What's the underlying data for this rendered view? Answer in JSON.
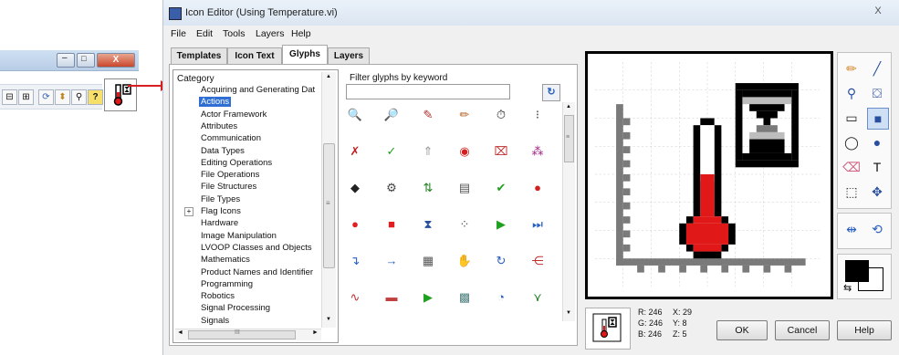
{
  "lv_window": {
    "close_glyph": "X",
    "min_glyph": "–",
    "max_glyph": "□",
    "toolbar_icons": [
      "align-icon",
      "distribute-icon",
      "resize-icon",
      "reorder-icon",
      "search-icon",
      "help-icon"
    ]
  },
  "dialog": {
    "title": "Icon Editor (Using Temperature.vi)",
    "close_glyph": "X",
    "menu": [
      "File",
      "Edit",
      "Tools",
      "Layers",
      "Help"
    ],
    "tabs": [
      "Templates",
      "Icon Text",
      "Glyphs",
      "Layers"
    ],
    "active_tab": "Glyphs"
  },
  "category": {
    "header": "Category",
    "items": [
      "Acquiring and Generating Dat",
      "Actions",
      "Actor Framework",
      "Attributes",
      "Communication",
      "Data Types",
      "Editing Operations",
      "File Operations",
      "File Structures",
      "File Types",
      "Flag Icons",
      "Hardware",
      "Image Manipulation",
      "LVOOP Classes and Objects",
      "Mathematics",
      "Product Names and Identifier",
      "Programming",
      "Robotics",
      "Signal Processing",
      "Signals"
    ],
    "selected": "Actions",
    "expand_glyph": "+",
    "scroll_up": "▲",
    "scroll_down": "▼",
    "scroll_left": "◄",
    "scroll_right": "►",
    "grip": "≡",
    "hgrip": "III"
  },
  "glyphs": {
    "filter_label": "Filter glyphs by keyword",
    "filter_value": "",
    "filter_button": "↻",
    "scroll_up": "▲",
    "scroll_down": "▼",
    "grip": "≡",
    "items": [
      {
        "icon": "zoom-icon",
        "glyph": "🔍",
        "color": "#333"
      },
      {
        "icon": "zoom-in-icon",
        "glyph": "🔎",
        "color": "#333"
      },
      {
        "icon": "pen-icon",
        "glyph": "✎",
        "color": "#b03030"
      },
      {
        "icon": "pencil-icon",
        "glyph": "✏",
        "color": "#b06020"
      },
      {
        "icon": "stopwatch-icon",
        "glyph": "⏱",
        "color": "#222"
      },
      {
        "icon": "cursor-icon",
        "glyph": "⁝",
        "color": "#333"
      },
      {
        "icon": "reject-icon",
        "glyph": "✗",
        "color": "#c02020"
      },
      {
        "icon": "check-icon",
        "glyph": "✓",
        "color": "#20a020"
      },
      {
        "icon": "up-chevrons-icon",
        "glyph": "⇑",
        "color": "#999"
      },
      {
        "icon": "record-icon",
        "glyph": "◉",
        "color": "#d02020"
      },
      {
        "icon": "cancel-doc-icon",
        "glyph": "⌧",
        "color": "#c03030"
      },
      {
        "icon": "multi-x-icon",
        "glyph": "⁂",
        "color": "#a02080"
      },
      {
        "icon": "graduation-icon",
        "glyph": "◆",
        "color": "#222"
      },
      {
        "icon": "gear-icon",
        "glyph": "⚙",
        "color": "#444"
      },
      {
        "icon": "sort-icon",
        "glyph": "⇅",
        "color": "#208020"
      },
      {
        "icon": "document-icon",
        "glyph": "▤",
        "color": "#555"
      },
      {
        "icon": "small-check-icon",
        "glyph": "✔",
        "color": "#20a020"
      },
      {
        "icon": "red-dot-icon",
        "glyph": "●",
        "color": "#d02020"
      },
      {
        "icon": "record-button-icon",
        "glyph": "●",
        "color": "#e02020"
      },
      {
        "icon": "stop-icon",
        "glyph": "■",
        "color": "#e02020"
      },
      {
        "icon": "hourglass-icon",
        "glyph": "⧗",
        "color": "#2a50a0"
      },
      {
        "icon": "dots-icon",
        "glyph": "⁘",
        "color": "#444"
      },
      {
        "icon": "run-icon",
        "glyph": "▶",
        "color": "#20a020"
      },
      {
        "icon": "next-icon",
        "glyph": "⏭",
        "color": "#2a60c0"
      },
      {
        "icon": "turn-arrow-icon",
        "glyph": "↴",
        "color": "#2a60c0"
      },
      {
        "icon": "arrow-right-icon",
        "glyph": "→",
        "color": "#2a60c0"
      },
      {
        "icon": "notes-icon",
        "glyph": "▦",
        "color": "#555"
      },
      {
        "icon": "hand-icon",
        "glyph": "✋",
        "color": "#b07020"
      },
      {
        "icon": "loop-icon",
        "glyph": "↻",
        "color": "#2a60c0"
      },
      {
        "icon": "tree-icon",
        "glyph": "⋲",
        "color": "#c03030"
      },
      {
        "icon": "signal-icon",
        "glyph": "∿",
        "color": "#c03030"
      },
      {
        "icon": "bar-icon",
        "glyph": "▬",
        "color": "#c04040"
      },
      {
        "icon": "play-icon",
        "glyph": "▶",
        "color": "#20a020"
      },
      {
        "icon": "stack-icon",
        "glyph": "▩",
        "color": "#508080"
      },
      {
        "icon": "timer-icon",
        "glyph": "◔",
        "color": "#2a60c0"
      },
      {
        "icon": "merge-icon",
        "glyph": "⋎",
        "color": "#208020"
      }
    ]
  },
  "canvas": {
    "pixel_colors": {
      "black": "#000000",
      "red": "#e01818",
      "gray": "#7a7a7a",
      "light_gray": "#bdbdbd",
      "white": "#ffffff"
    }
  },
  "tools": [
    {
      "icon": "pencil-icon",
      "glyph": "✏",
      "color": "#d08020"
    },
    {
      "icon": "line-icon",
      "glyph": "╱",
      "color": "#2a4fa0"
    },
    {
      "icon": "dropper-icon",
      "glyph": "⚲",
      "color": "#2a4fa0"
    },
    {
      "icon": "fill-bucket-icon",
      "glyph": "⛋",
      "color": "#2a4fa0"
    },
    {
      "icon": "rectangle-icon",
      "glyph": "▭",
      "color": "#222"
    },
    {
      "icon": "filled-rectangle-icon",
      "glyph": "■",
      "color": "#2a4fa0"
    },
    {
      "icon": "ellipse-icon",
      "glyph": "◯",
      "color": "#222"
    },
    {
      "icon": "filled-ellipse-icon",
      "glyph": "●",
      "color": "#2a4fa0"
    },
    {
      "icon": "eraser-icon",
      "glyph": "⌫",
      "color": "#d06080"
    },
    {
      "icon": "text-icon",
      "glyph": "T",
      "color": "#111"
    },
    {
      "icon": "select-icon",
      "glyph": "⬚",
      "color": "#222"
    },
    {
      "icon": "move-icon",
      "glyph": "✥",
      "color": "#2a4fa0"
    }
  ],
  "tools2": [
    {
      "icon": "flip-horizontal-icon",
      "glyph": "⇹",
      "color": "#2a60c0"
    },
    {
      "icon": "rotate-icon",
      "glyph": "⟲",
      "color": "#2a60c0"
    }
  ],
  "colors": {
    "foreground": "#000000",
    "background": "#ffffff",
    "swap_glyph": "⇆"
  },
  "readout": {
    "r": "R: 246",
    "g": "G: 246",
    "b": "B: 246",
    "x": "X: 29",
    "y": "Y: 8",
    "z": "Z: 5"
  },
  "buttons": {
    "ok": "OK",
    "cancel": "Cancel",
    "help": "Help"
  }
}
